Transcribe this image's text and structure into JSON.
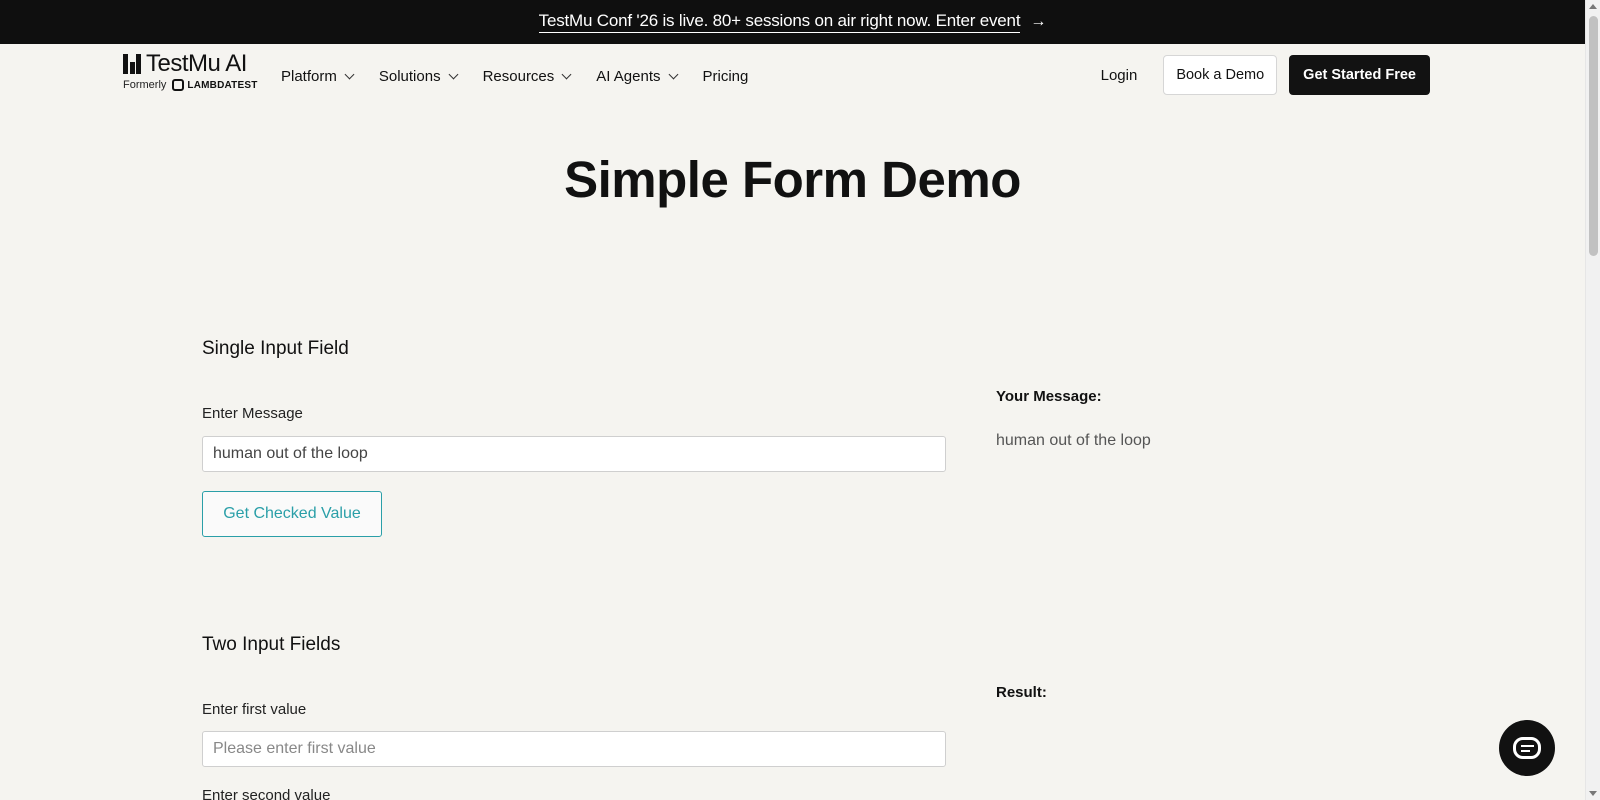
{
  "announcement": {
    "text": "TestMu Conf '26 is live. 80+ sessions on air right now. Enter event",
    "arrow_icon": "arrow-right-icon"
  },
  "header": {
    "logo": {
      "name": "TestMu AI",
      "formerly": "Formerly",
      "former_brand": "LAMBDATEST"
    },
    "nav": [
      {
        "label": "Platform",
        "has_dropdown": true
      },
      {
        "label": "Solutions",
        "has_dropdown": true
      },
      {
        "label": "Resources",
        "has_dropdown": true
      },
      {
        "label": "AI Agents",
        "has_dropdown": true
      },
      {
        "label": "Pricing",
        "has_dropdown": false
      }
    ],
    "login": "Login",
    "book_demo": "Book a Demo",
    "get_started": "Get Started Free"
  },
  "page": {
    "title": "Simple Form Demo"
  },
  "single_input": {
    "section_title": "Single Input Field",
    "label": "Enter Message",
    "value": "human out of the loop",
    "button": "Get Checked Value",
    "result_label": "Your Message:",
    "result_value": "human out of the loop"
  },
  "two_inputs": {
    "section_title": "Two Input Fields",
    "first_label": "Enter first value",
    "first_placeholder": "Please enter first value",
    "second_label": "Enter second value",
    "result_label": "Result:"
  },
  "colors": {
    "background": "#f5f4f0",
    "announcement_bg": "#0f0f0f",
    "accent_teal": "#2a9fa8",
    "dark_button": "#121212"
  },
  "chat": {
    "icon": "chat-bubble-icon"
  }
}
